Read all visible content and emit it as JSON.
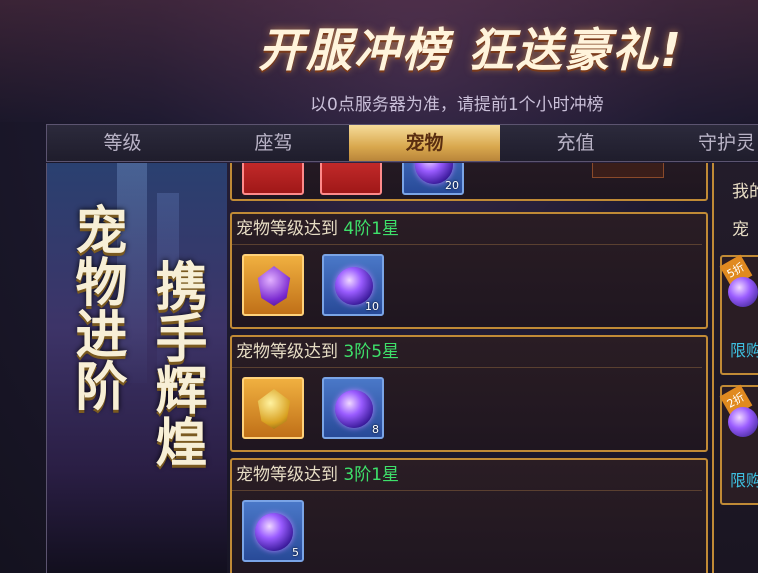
{
  "banner": {
    "title": "开服冲榜 狂送豪礼!",
    "subtitle": "以0点服务器为准，请提前1个小时冲榜"
  },
  "tabs": [
    {
      "label": "等级",
      "active": false
    },
    {
      "label": "座驾",
      "active": false
    },
    {
      "label": "宠物",
      "active": true
    },
    {
      "label": "充值",
      "active": false
    },
    {
      "label": "守护灵",
      "active": false
    }
  ],
  "left_art": {
    "col1": "宠物进阶",
    "col2": "携手辉煌"
  },
  "partial_top_card": {
    "items": [
      {
        "icon": "red-item-icon"
      },
      {
        "icon": "red-gift-icon"
      },
      {
        "icon": "purple-orb-icon",
        "count": "20"
      }
    ]
  },
  "cards": [
    {
      "prefix": "宠物等级达到 ",
      "level": "4阶1星",
      "items": [
        {
          "icon": "purple-pet-gem-icon",
          "count": ""
        },
        {
          "icon": "purple-orb-icon",
          "count": "10"
        }
      ]
    },
    {
      "prefix": "宠物等级达到 ",
      "level": "3阶5星",
      "items": [
        {
          "icon": "yellow-pet-gem-icon",
          "count": ""
        },
        {
          "icon": "purple-orb-icon",
          "count": "8"
        }
      ]
    },
    {
      "prefix": "宠物等级达到 ",
      "level": "3阶1星",
      "items": [
        {
          "icon": "purple-orb-icon",
          "count": "5"
        }
      ]
    }
  ],
  "right_panel": {
    "line1": "我的",
    "line2": "宠",
    "offers": [
      {
        "discount": "5折",
        "limit": "限购"
      },
      {
        "discount": "2折",
        "limit": "限购"
      }
    ]
  },
  "colors": {
    "accent_gold": "#c08a36",
    "level_green": "#3ee06a",
    "limit_cyan": "#3ec0e0"
  }
}
